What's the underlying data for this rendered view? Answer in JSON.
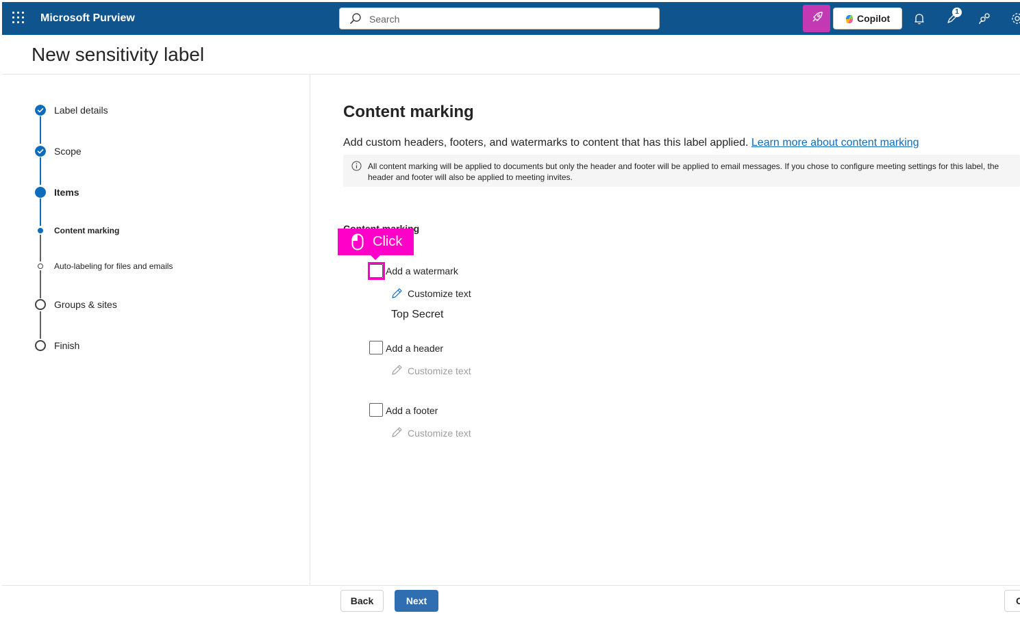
{
  "topbar": {
    "app_name": "Microsoft Purview",
    "search_placeholder": "Search",
    "copilot_label": "Copilot",
    "notification_badge": "1",
    "icons": [
      "app-launcher-icon",
      "search-icon",
      "rocket-icon",
      "copilot-icon",
      "bell-icon",
      "feedback-icon",
      "people-icon",
      "settings-icon"
    ]
  },
  "page": {
    "title": "New sensitivity label"
  },
  "stepper": {
    "steps": [
      {
        "label": "Label details",
        "state": "completed"
      },
      {
        "label": "Scope",
        "state": "completed"
      },
      {
        "label": "Items",
        "state": "current"
      },
      {
        "label": "Content marking",
        "state": "current-sub"
      },
      {
        "label": "Auto-labeling for files and emails",
        "state": "upcoming-sub"
      },
      {
        "label": "Groups & sites",
        "state": "upcoming"
      },
      {
        "label": "Finish",
        "state": "upcoming"
      }
    ]
  },
  "main": {
    "title": "Content marking",
    "description": "Add custom headers, footers, and watermarks to content that has this label applied.",
    "learn_more_link": "Learn more about content marking",
    "info_text": "All content marking will be applied to documents but only the header and footer will be applied to email messages. If you chose to configure meeting settings for this label, the header and footer will also be applied to meeting invites.",
    "section_label": "Content marking",
    "options": [
      {
        "label": "Add a watermark",
        "checked": false,
        "customize_label": "Customize text",
        "customize_enabled": true,
        "value_text": "Top Secret"
      },
      {
        "label": "Add a header",
        "checked": false,
        "customize_label": "Customize text",
        "customize_enabled": false
      },
      {
        "label": "Add a footer",
        "checked": false,
        "customize_label": "Customize text",
        "customize_enabled": false
      }
    ]
  },
  "annotation": {
    "click_label": "Click",
    "color": "#ff00c8"
  },
  "footer": {
    "back_label": "Back",
    "next_label": "Next",
    "cancel_label_partial": "C"
  },
  "colors": {
    "topbar": "#0f548c",
    "accent": "#0f6cbd",
    "primary_button": "#2f6fb1",
    "rocket_button": "#c239b3"
  }
}
